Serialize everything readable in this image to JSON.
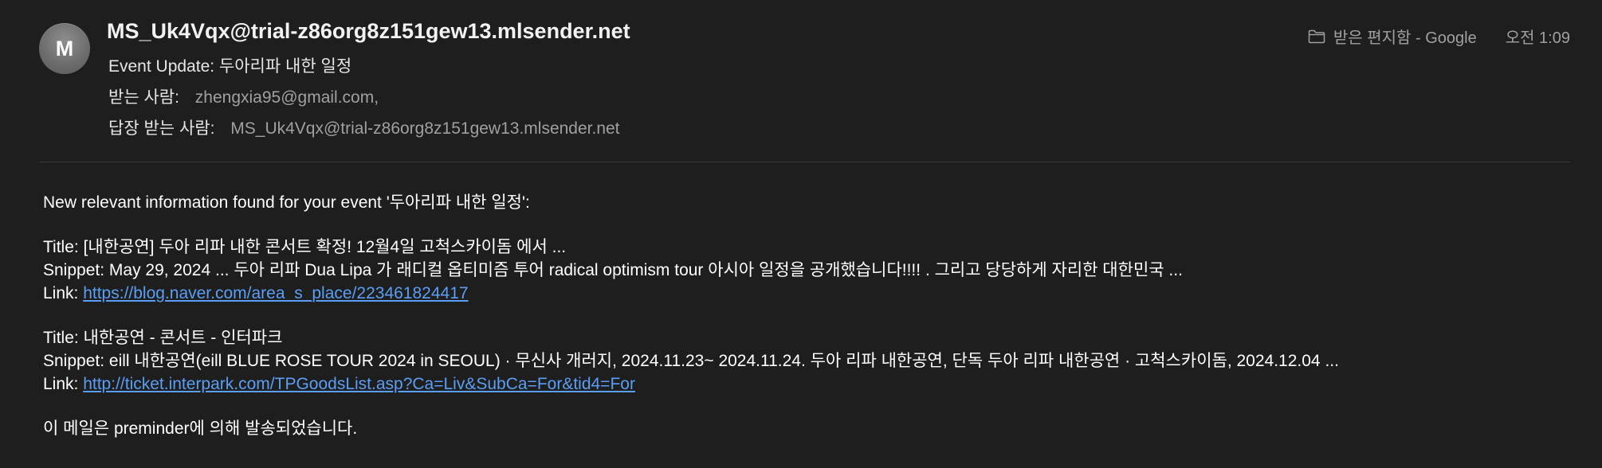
{
  "header": {
    "avatar_initial": "M",
    "sender": "MS_Uk4Vqx@trial-z86org8z151gew13.mlsender.net",
    "subject": "Event Update: 두아리파 내한 일정",
    "to_label": "받는 사람:",
    "to_value": "zhengxia95@gmail.com,",
    "reply_to_label": "답장 받는 사람:",
    "reply_to_value": "MS_Uk4Vqx@trial-z86org8z151gew13.mlsender.net",
    "folder_icon": "folder-icon",
    "folder": "받은 편지함 - Google",
    "time": "오전 1:09"
  },
  "body": {
    "intro": "New relevant information found for your event '두아리파 내한 일정':",
    "results": [
      {
        "title": "Title: [내한공연] 두아 리파 내한 콘서트 확정! 12월4일 고척스카이돔 에서 ...",
        "snippet": "Snippet: May 29, 2024 ... 두아 리파 Dua Lipa 가 래디컬 옵티미즘 투어 radical optimism tour 아시아 일정을 공개했습니다!!!! . 그리고 당당하게 자리한 대한민국 ...",
        "link_label": "Link: ",
        "link": "https://blog.naver.com/area_s_place/223461824417"
      },
      {
        "title": "Title: 내한공연 - 콘서트 - 인터파크",
        "snippet": "Snippet: eill 내한공연(eill BLUE ROSE TOUR 2024 in SEOUL) · 무신사 개러지, 2024.11.23~ 2024.11.24. 두아 리파 내한공연, 단독 두아 리파 내한공연 · 고척스카이돔, 2024.12.04 ...",
        "link_label": "Link: ",
        "link": "http://ticket.interpark.com/TPGoodsList.asp?Ca=Liv&SubCa=For&tid4=For"
      }
    ],
    "footer": "이 메일은 preminder에 의해 발송되었습니다."
  },
  "colors": {
    "background": "#1e1e1e",
    "link": "#5a9ef5",
    "muted": "#a0a0a0"
  }
}
